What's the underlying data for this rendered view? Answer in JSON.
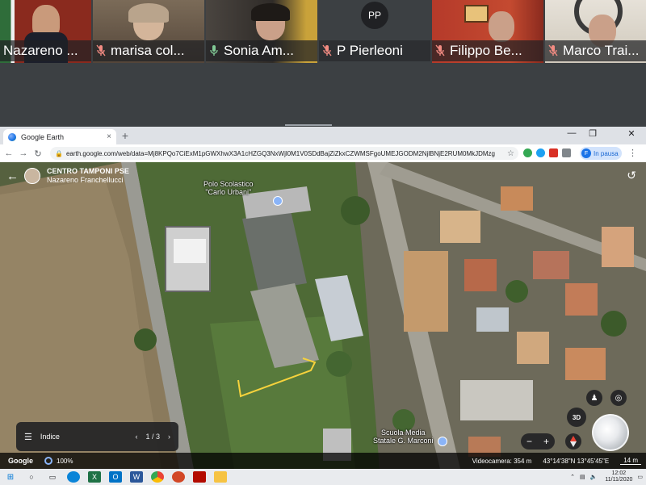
{
  "participants": [
    {
      "name": "Nazareno ...",
      "muted": false,
      "bg": "#8a2a1e"
    },
    {
      "name": "marisa col...",
      "muted": true,
      "bg": "#6b5a48"
    },
    {
      "name": "Sonia Am...",
      "muted": false,
      "bg": "#3e3a35"
    },
    {
      "name": "P Pierleoni",
      "muted": true,
      "initials": "PP",
      "bg": "#3c4043"
    },
    {
      "name": "Filippo Be...",
      "muted": true,
      "bg": "#b53a2a"
    },
    {
      "name": "Marco Trai...",
      "muted": true,
      "bg": "#d9d3c7"
    }
  ],
  "browser": {
    "tab_title": "Google Earth",
    "tab_close": "×",
    "new_tab": "+",
    "win_minimize": "—",
    "win_restore": "❐",
    "win_close": "✕",
    "url": "earth.google.com/web/data=Mj8KPQo7CiExM1pGWXhwX3A1cHZGQ3NxWjl0M1V0SDdBajZiZkxCZWMSFgoUMEJGODM2NjlBNjE2RUM0MkJDMzg",
    "profile_initial": "F",
    "profile_status": "In pausa"
  },
  "earth": {
    "project_title": "CENTRO TAMPONI PSE",
    "project_author": "Nazareno Franchellucci",
    "label_polo_line1": "Polo Scolastico",
    "label_polo_line2": "\"Carlo Urbani\"",
    "label_scuola_line1": "Scuola Media",
    "label_scuola_line2": "Statale G. Marconi",
    "indice_label": "Indice",
    "pager_text": "1 / 3",
    "btn_3d": "3D",
    "google_logo": "Google",
    "loading_pct": "100%",
    "camera": "Videocamera: 354 m",
    "coords": "43°14'38\"N 13°45'45\"E",
    "scale": "14 m"
  },
  "taskbar": {
    "time": "12:02",
    "date": "11/11/2020"
  }
}
